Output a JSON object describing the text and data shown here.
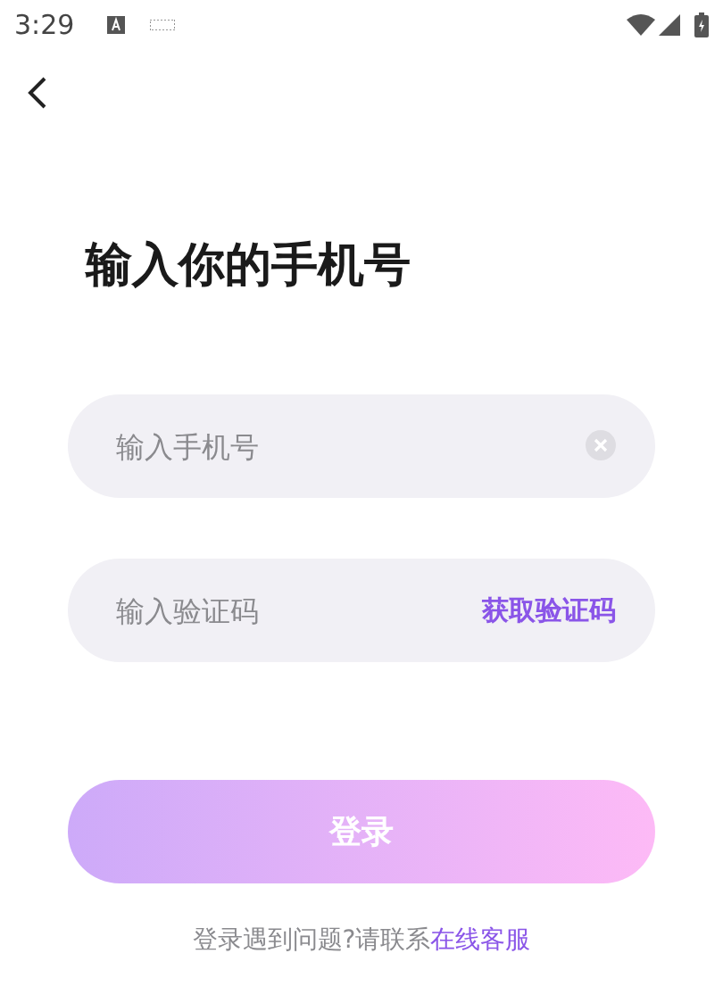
{
  "status_bar": {
    "time": "3:29"
  },
  "title": "输入你的手机号",
  "phone_field": {
    "placeholder": "输入手机号"
  },
  "code_field": {
    "placeholder": "输入验证码",
    "action": "获取验证码"
  },
  "login_button": {
    "label": "登录",
    "disabled": true
  },
  "footer": {
    "text": "登录遇到问题?请联系",
    "link": "在线客服"
  }
}
